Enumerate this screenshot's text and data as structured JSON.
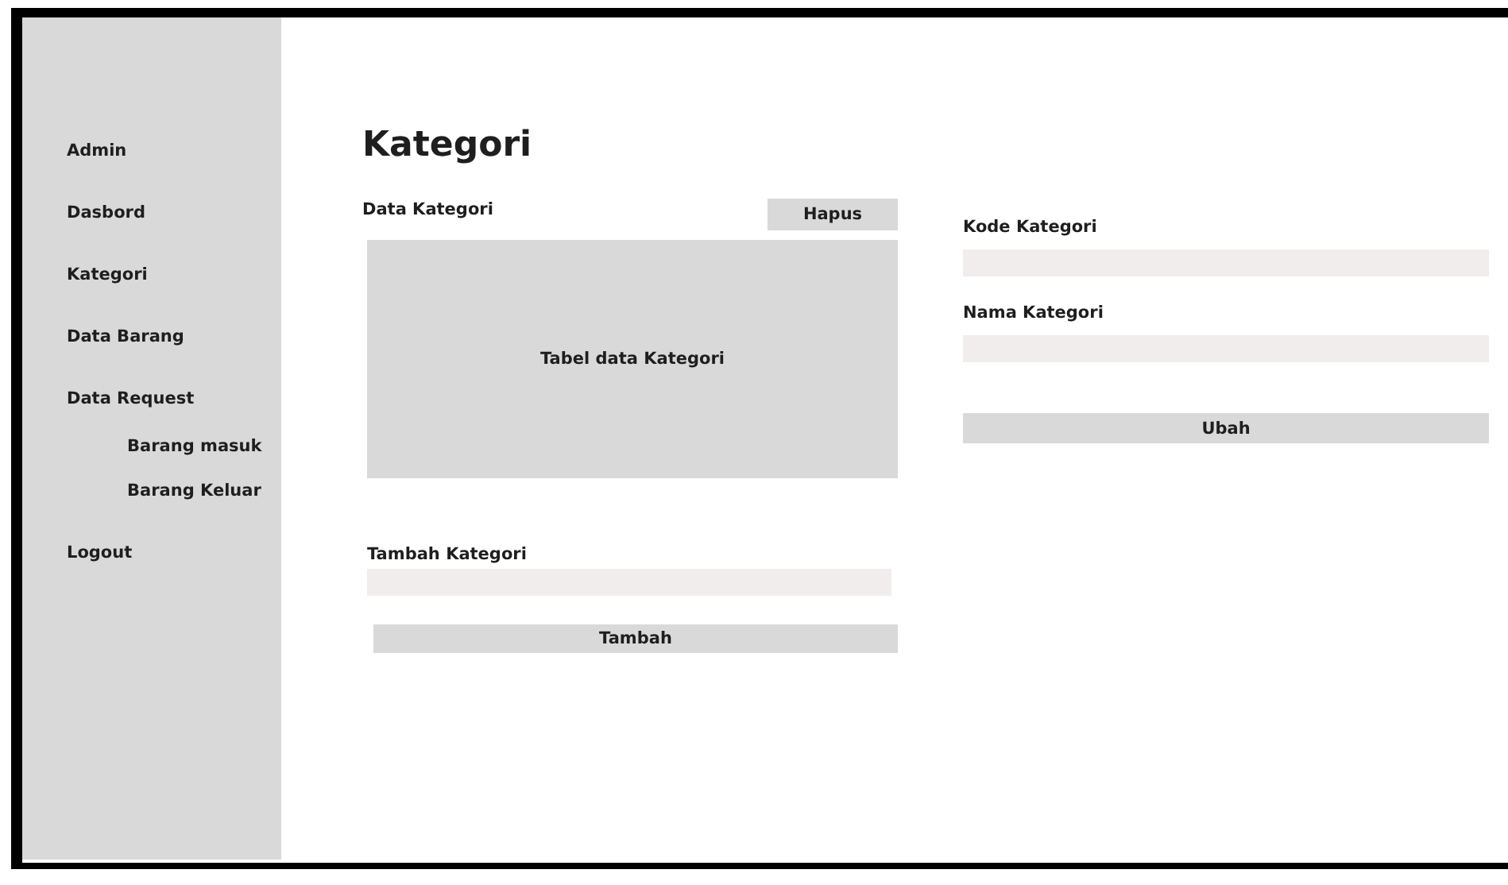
{
  "sidebar": {
    "items": [
      {
        "label": "Admin"
      },
      {
        "label": "Dasbord"
      },
      {
        "label": "Kategori"
      },
      {
        "label": "Data Barang"
      },
      {
        "label": "Data Request",
        "children": [
          {
            "label": "Barang masuk"
          },
          {
            "label": "Barang Keluar"
          }
        ]
      },
      {
        "label": "Logout"
      }
    ]
  },
  "page_title": "Kategori",
  "data_panel": {
    "label": "Data Kategori",
    "delete_button": "Hapus",
    "table_placeholder": "Tabel data Kategori"
  },
  "add_form": {
    "label": "Tambah Kategori",
    "button": "Tambah"
  },
  "edit_form": {
    "fields": [
      {
        "label": "Kode Kategori"
      },
      {
        "label": "Nama Kategori"
      }
    ],
    "button": "Ubah"
  }
}
